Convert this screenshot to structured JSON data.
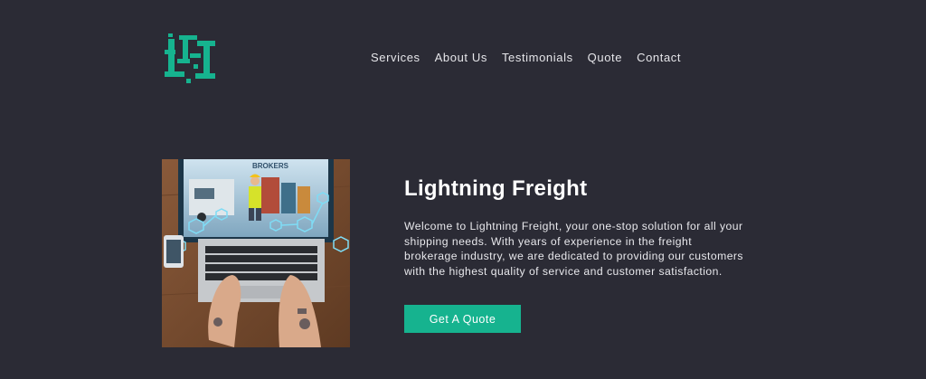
{
  "brand": {
    "logo_icon": "lightning-freight-logo-icon",
    "accent_color": "#16b38f"
  },
  "nav": {
    "items": [
      {
        "label": "Services"
      },
      {
        "label": "About Us"
      },
      {
        "label": "Testimonials"
      },
      {
        "label": "Quote"
      },
      {
        "label": "Contact"
      }
    ]
  },
  "hero": {
    "image_icon": "laptop-freight-illustration",
    "image_text": "BROKERS",
    "title": "Lightning Freight",
    "description": "Welcome to Lightning Freight, your one-stop solution for all your shipping needs. With years of experience in the freight brokerage industry, we are dedicated to providing our customers with the highest quality of service and customer satisfaction.",
    "cta_label": "Get A Quote"
  },
  "colors": {
    "background": "#2b2b35",
    "text": "#ffffff",
    "button": "#16b38f"
  }
}
